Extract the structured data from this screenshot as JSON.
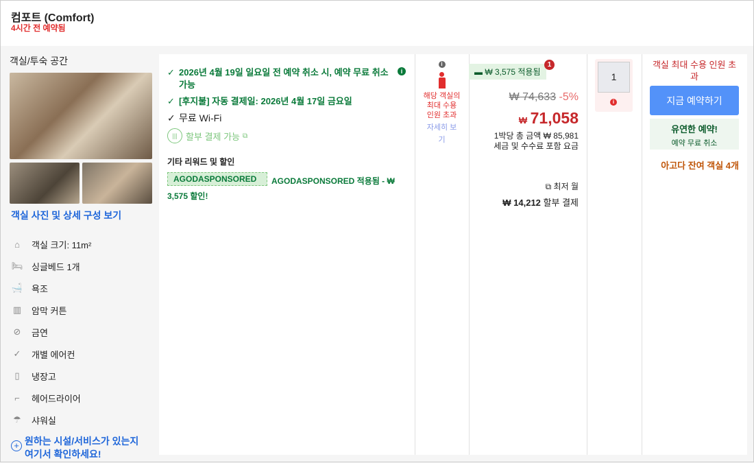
{
  "header": {
    "title": "컴포트 (Comfort)",
    "booked": "4시간 전 예약됨"
  },
  "left": {
    "title": "객실/투숙 공간",
    "photo_link": "객실 사진 및 상세 구성 보기",
    "facilities": [
      {
        "icon": "room-size-icon",
        "label": "객실 크기: 11m²"
      },
      {
        "icon": "bed-icon",
        "label": "싱글베드 1개"
      },
      {
        "icon": "bathtub-icon",
        "label": "욕조"
      },
      {
        "icon": "curtain-icon",
        "label": "암막 커튼"
      },
      {
        "icon": "no-smoking-icon",
        "label": "금연"
      },
      {
        "icon": "aircon-icon",
        "label": "개별 에어컨"
      },
      {
        "icon": "fridge-icon",
        "label": "냉장고"
      },
      {
        "icon": "hairdryer-icon",
        "label": "헤어드라이어"
      },
      {
        "icon": "shower-icon",
        "label": "샤워실"
      }
    ],
    "more_line1": "원하는 시설/서비스가 있는지",
    "more_line2": "여기서 확인하세요!"
  },
  "benefits": {
    "cancel": "2026년 4월 19일 일요일 전 예약 취소 시, 예약 무료 취소 가능",
    "pay_later": "[후지불] 자동 결제일: 2026년 4월 17일 금요일",
    "wifi": "무료 Wi-Fi",
    "installment": "할부 결제 가능",
    "rewards_title": "기타 리워드 및 할인",
    "coupon_tag": "AGODASPONSORED",
    "coupon_text": "AGODASPONSORED 적용됨 - ₩ 3,575 할인!"
  },
  "occupancy": {
    "warning": "해당 객실의 최대 수용 인원 초과",
    "details": "자세히 보기"
  },
  "price": {
    "coupon_badge": "₩ 3,575 적용됨",
    "badge_count": "1",
    "original": "₩ 74,633",
    "discount": "-5%",
    "currency": "₩",
    "final": "71,058",
    "per_night": "1박당 총 금액 ₩ 85,981",
    "tax_note": "세금 및 수수료 포함 요금",
    "monthly_label": "최저 월",
    "monthly_amount": "₩ 14,212",
    "monthly_suffix": "할부 결제"
  },
  "rooms": {
    "quantity": "1"
  },
  "booking": {
    "over_capacity": "객실 최대 수용 인원 초과",
    "book_now": "지금 예약하기",
    "flex_title": "유연한 예약!",
    "flex_sub": "예약 무료 취소",
    "remaining": "아고다 잔여 객실 4개"
  },
  "colors": {
    "green": "#0a7a3a",
    "red": "#e12d2d",
    "blue": "#2067da",
    "button": "#5392f9"
  }
}
